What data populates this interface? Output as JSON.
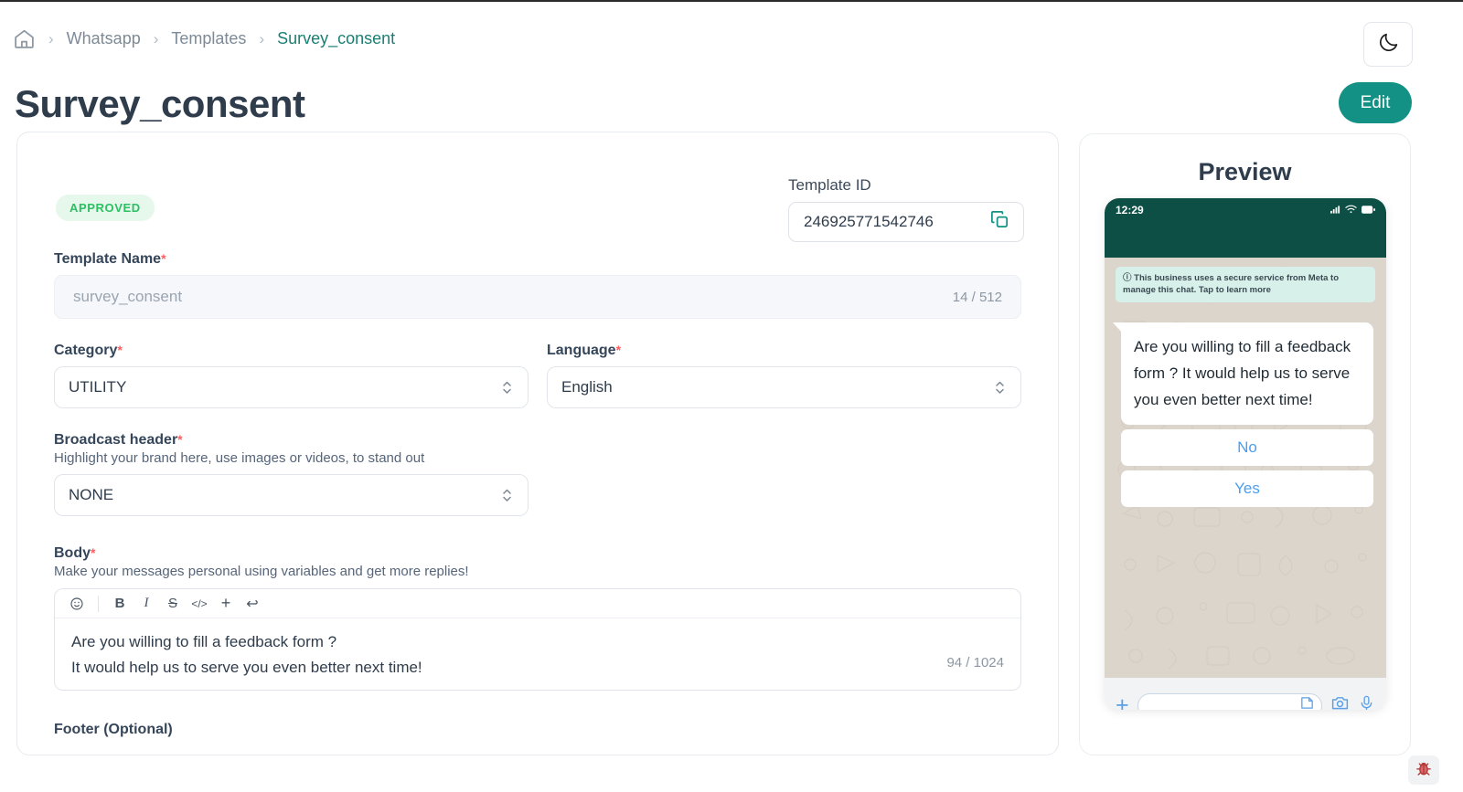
{
  "breadcrumb": {
    "home_icon": "home-icon",
    "separator": "›",
    "items": [
      {
        "label": "Whatsapp",
        "active": false
      },
      {
        "label": "Templates",
        "active": false
      },
      {
        "label": "Survey_consent",
        "active": true
      }
    ]
  },
  "header": {
    "title": "Survey_consent",
    "theme_toggle_icon": "moon-icon",
    "edit_label": "Edit"
  },
  "form": {
    "status_badge": "APPROVED",
    "template_id": {
      "label": "Template ID",
      "value": "246925771542746",
      "copy_icon": "copy-icon"
    },
    "template_name": {
      "label": "Template Name",
      "required_mark": "*",
      "placeholder": "survey_consent",
      "value": "",
      "counter": "14 / 512"
    },
    "category": {
      "label": "Category",
      "required_mark": "*",
      "value": "UTILITY",
      "stepper_icon": "chevron-updown-icon"
    },
    "language": {
      "label": "Language",
      "required_mark": "*",
      "value": "English",
      "stepper_icon": "chevron-updown-icon"
    },
    "broadcast_header": {
      "label": "Broadcast header",
      "required_mark": "*",
      "hint": "Highlight your brand here, use images or videos, to stand out",
      "value": "NONE",
      "stepper_icon": "chevron-updown-icon"
    },
    "body": {
      "label": "Body",
      "required_mark": "*",
      "hint": "Make your messages personal using variables and get more replies!",
      "toolbar": [
        {
          "name": "emoji-icon",
          "glyph": "☺"
        },
        {
          "name": "bold-icon",
          "glyph": "B"
        },
        {
          "name": "italic-icon",
          "glyph": "I"
        },
        {
          "name": "strikethrough-icon",
          "glyph": "S"
        },
        {
          "name": "code-icon",
          "glyph": "</>"
        },
        {
          "name": "add-variable-icon",
          "glyph": "+"
        },
        {
          "name": "undo-icon",
          "glyph": "↩"
        }
      ],
      "line1": "Are you willing to fill a feedback form ?",
      "line2": "It would help us to serve you even better next time!",
      "counter": "94 / 1024"
    },
    "footer": {
      "label": "Footer (Optional)"
    }
  },
  "preview": {
    "title": "Preview",
    "phone": {
      "time": "12:29",
      "status_icons": [
        "signal-icon",
        "wifi-icon",
        "battery-icon"
      ],
      "secure_notice_icon": "info-icon",
      "secure_notice": "This business uses a secure service from Meta to manage this chat. Tap to learn more",
      "message": "Are you willing to fill a feedback form ?\nIt would help us to serve you even better next time!",
      "buttons": [
        {
          "label": "No"
        },
        {
          "label": "Yes"
        }
      ],
      "input_bar": {
        "plus_icon": "plus-icon",
        "placeholder": "",
        "sticker_icon": "sticker-icon",
        "camera_icon": "camera-icon",
        "mic_icon": "microphone-icon"
      }
    }
  },
  "bug_button": {
    "icon": "bug-icon"
  },
  "colors": {
    "accent_teal": "#139184",
    "breadcrumb_active": "#1a7f72",
    "badge_bg": "#e6f8ec",
    "badge_text": "#2cc063",
    "whatsapp_header": "#0d4f44",
    "chat_bg": "#dcd5cc",
    "reply_link": "#4a9ef0",
    "required_red": "#ff5c5c"
  }
}
